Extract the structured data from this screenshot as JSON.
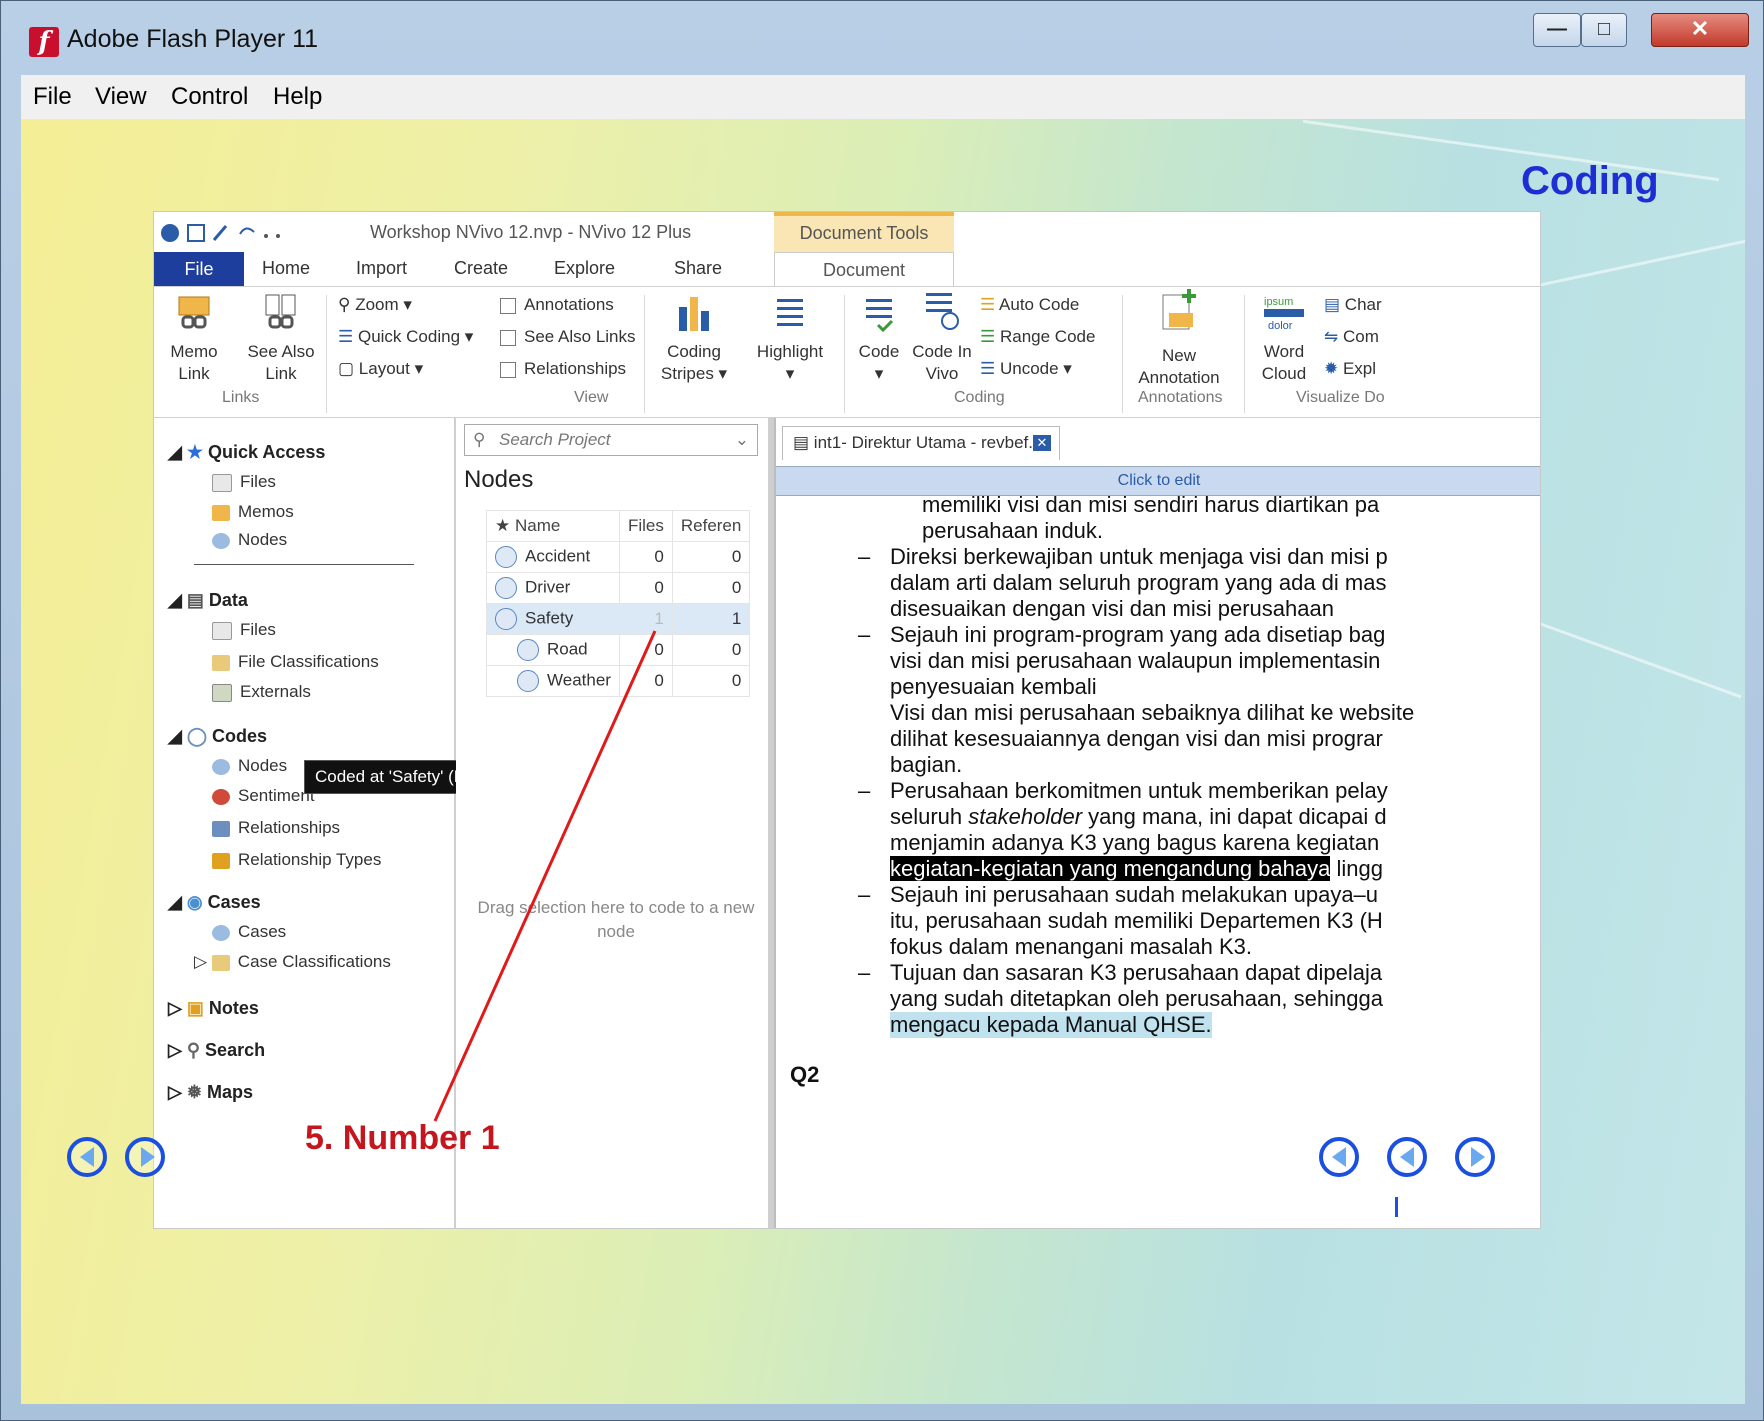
{
  "window": {
    "title": "Adobe Flash Player 11",
    "logo_letter": "f"
  },
  "menu": [
    "File",
    "View",
    "Control",
    "Help"
  ],
  "slide": {
    "heading": "Coding",
    "annotation": "5. Number 1"
  },
  "nvivo": {
    "window_title": "Workshop NVivo 12.nvp - NVivo 12 Plus",
    "tools_tab": "Document Tools",
    "tabs": [
      "File",
      "Home",
      "Import",
      "Create",
      "Explore",
      "Share",
      "Document"
    ],
    "ribbon": {
      "memo_link": "Memo Link",
      "see_also_link": "See Also Link",
      "zoom": "Zoom",
      "quick_coding": "Quick Coding",
      "layout": "Layout",
      "annotations": "Annotations",
      "see_also_links": "See Also Links",
      "relationships": "Relationships",
      "coding_stripes": "Coding Stripes",
      "highlight": "Highlight",
      "code": "Code",
      "code_in_vivo": "Code In Vivo",
      "auto_code": "Auto Code",
      "range_code": "Range Code",
      "uncode": "Uncode",
      "new_annotation": "New Annotation",
      "word_cloud": "Word Cloud",
      "chart": "Char",
      "compare": "Com",
      "explore": "Expl",
      "groups": {
        "links": "Links",
        "view": "View",
        "coding": "Coding",
        "annotations": "Annotations",
        "visualize": "Visualize Do"
      }
    },
    "nav": {
      "quick_access": "Quick Access",
      "qa_files": "Files",
      "qa_memos": "Memos",
      "qa_nodes": "Nodes",
      "data": "Data",
      "data_files": "Files",
      "file_classifications": "File Classifications",
      "externals": "Externals",
      "codes": "Codes",
      "codes_nodes": "Nodes",
      "sentiment": "Sentiment",
      "relationships": "Relationships",
      "relationship_types": "Relationship Types",
      "cases": "Cases",
      "cases_cases": "Cases",
      "case_classifications": "Case Classifications",
      "notes": "Notes",
      "search": "Search",
      "maps": "Maps",
      "tooltip": "Coded at 'Safety' (Nodes)"
    },
    "nodes_panel": {
      "search_placeholder": "Search Project",
      "title": "Nodes",
      "headers": [
        "Name",
        "Files",
        "Referen"
      ],
      "rows": [
        {
          "name": "Accident",
          "files": "0",
          "refs": "0"
        },
        {
          "name": "Driver",
          "files": "0",
          "refs": "0"
        },
        {
          "name": "Safety",
          "files": "1",
          "refs": "1"
        },
        {
          "name": "Road",
          "files": "0",
          "refs": "0"
        },
        {
          "name": "Weather",
          "files": "0",
          "refs": "0"
        }
      ],
      "drag_hint": "Drag selection here to code to a new node"
    },
    "document": {
      "tab_title": "int1- Direktur Utama - revbef.",
      "click_to_edit": "Click to edit",
      "lines": {
        "l1": "memiliki visi dan misi sendiri harus diartikan pa",
        "l2": "perusahaan induk.",
        "l3": "Direksi berkewajiban untuk menjaga visi dan misi p",
        "l4": "dalam arti dalam seluruh program yang ada di mas",
        "l5": "disesuaikan dengan visi dan misi perusahaan",
        "l6": "Sejauh ini program-program yang ada disetiap bag",
        "l7": "visi dan misi perusahaan walaupun implementasin",
        "l8": "penyesuaian kembali",
        "l9": "Visi dan misi perusahaan sebaiknya dilihat ke website",
        "l10": "dilihat kesesuaiannya dengan visi dan misi prograr",
        "l11": "bagian.",
        "l12": "Perusahaan berkomitmen untuk memberikan pelay",
        "l13a": "seluruh ",
        "l13b": "stakeholder",
        "l13c": " yang mana, ini dapat dicapai d",
        "l14": "menjamin adanya K3 yang bagus karena kegiatan",
        "l15a": "kegiatan-kegiatan yang mengandung bahaya",
        "l15b": " lingg",
        "l16": "Sejauh ini perusahaan sudah melakukan upaya–u",
        "l17": "itu, perusahaan sudah memiliki Departemen K3 (H",
        "l18": "fokus dalam menangani masalah K3.",
        "l19": "Tujuan dan sasaran K3 perusahaan dapat dipelaja",
        "l20": "yang sudah ditetapkan oleh perusahaan, sehingga",
        "l21": "mengacu kepada Manual QHSE.",
        "q2": "Q2",
        "dash": "–"
      }
    }
  },
  "colors": {
    "heading": "#1d2fd4",
    "annotation": "#c4161c",
    "nav_button": "#1a4fe0"
  }
}
